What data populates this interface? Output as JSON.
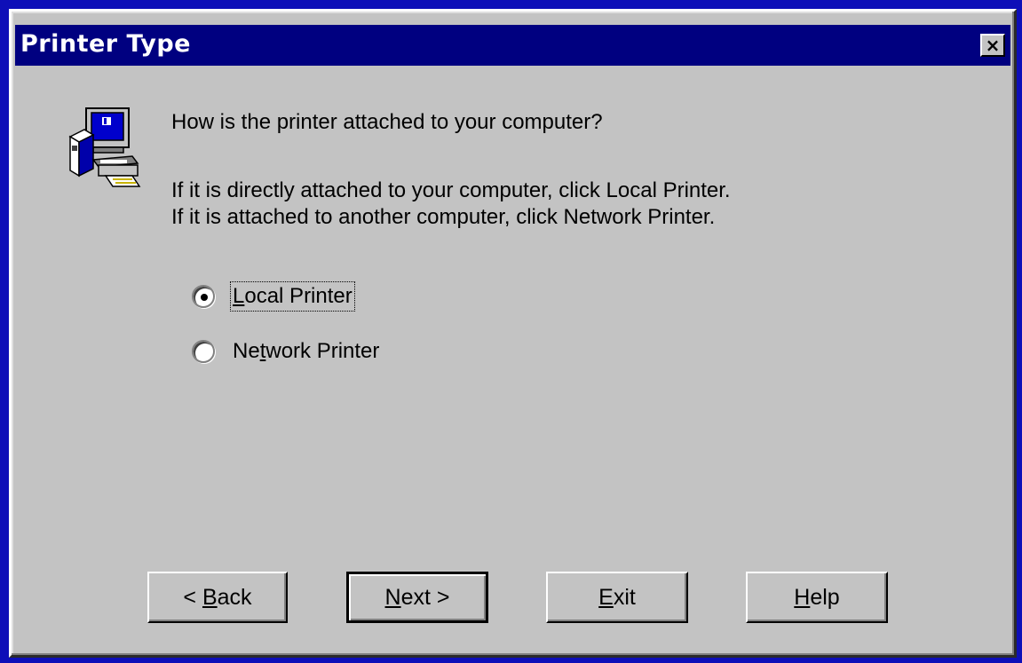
{
  "window": {
    "title": "Printer Type",
    "close_label": "×"
  },
  "content": {
    "question": "How is the printer attached to your computer?",
    "info_line1": "If it is directly attached to your computer, click Local Printer.",
    "info_line2": "If it is attached to another computer, click Network Printer."
  },
  "options": {
    "local": {
      "mnemonic": "L",
      "rest": "ocal Printer",
      "checked": true
    },
    "network": {
      "pre": "Ne",
      "mnemonic": "t",
      "rest": "work Printer",
      "checked": false
    }
  },
  "buttons": {
    "back": {
      "pre": "< ",
      "mnemonic": "B",
      "rest": "ack"
    },
    "next": {
      "pre": "",
      "mnemonic": "N",
      "rest": "ext >"
    },
    "exit": {
      "pre": "",
      "mnemonic": "E",
      "rest": "xit"
    },
    "help": {
      "pre": "",
      "mnemonic": "H",
      "rest": "elp"
    }
  },
  "icon": {
    "name": "printer-computer-icon"
  },
  "colors": {
    "desktop": "#0e0fb8",
    "titlebar": "#000080",
    "face": "#c3c3c3"
  }
}
